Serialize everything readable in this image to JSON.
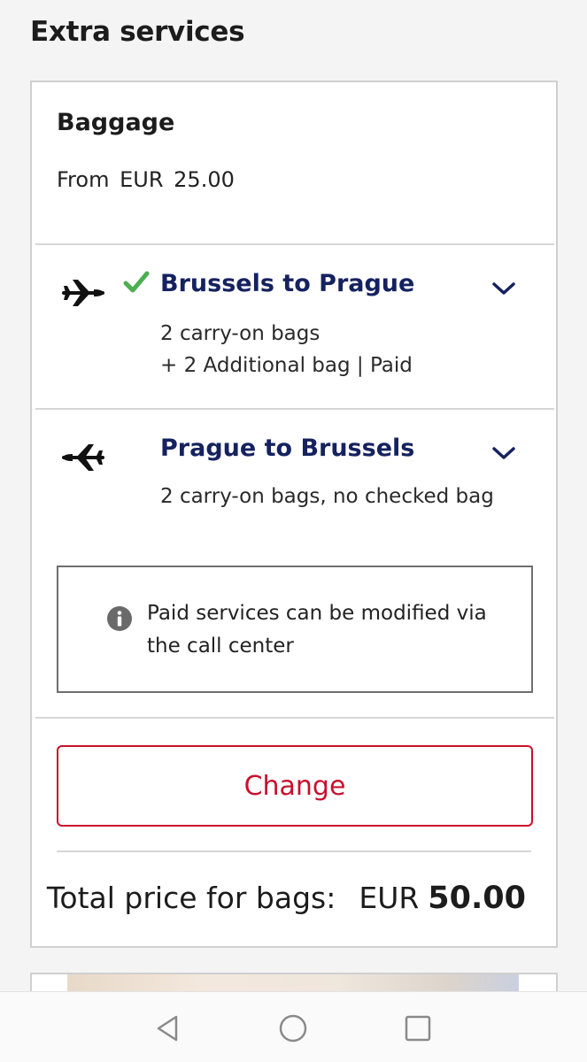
{
  "section": {
    "title": "Extra services"
  },
  "baggage": {
    "title": "Baggage",
    "from_label": "From",
    "from_currency": "EUR",
    "from_amount": "25.00"
  },
  "flights": [
    {
      "route": "Brussels to Prague",
      "status_icon": "check-icon",
      "details": [
        "2 carry-on bags",
        "+ 2 Additional bag | Paid"
      ]
    },
    {
      "route": "Prague to Brussels",
      "details": [
        "2 carry-on bags, no checked bag"
      ]
    }
  ],
  "info": {
    "icon": "info-icon",
    "message": "Paid services can be modified via the call center"
  },
  "actions": {
    "change_label": "Change"
  },
  "total": {
    "label": "Total price for bags:",
    "currency": "EUR",
    "amount": "50.00"
  },
  "colors": {
    "route_navy": "#15225f",
    "accent_red": "#c8102e",
    "check_green": "#4caf50"
  },
  "navigation_bar": {
    "buttons": [
      "back-icon",
      "home-icon",
      "recents-icon"
    ]
  }
}
